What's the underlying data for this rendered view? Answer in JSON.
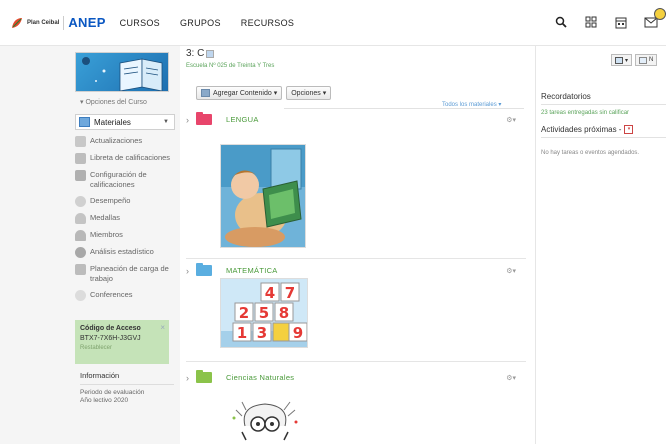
{
  "header": {
    "ceibal_label": "Plan Ceibal",
    "anep_label": "ANEP",
    "nav": [
      "CURSOS",
      "GRUPOS",
      "RECURSOS"
    ],
    "notification_count": ""
  },
  "sidebar": {
    "course_options": "▾ Opciones del Curso",
    "materials_select": "Materiales",
    "items": [
      {
        "label": "Actualizaciones",
        "icon": "updates-icon"
      },
      {
        "label": "Libreta de calificaciones",
        "icon": "gradebook-icon"
      },
      {
        "label": "Configuración de calificaciones",
        "icon": "grade-settings-icon"
      },
      {
        "label": "Desempeño",
        "icon": "performance-icon"
      },
      {
        "label": "Medallas",
        "icon": "badges-icon"
      },
      {
        "label": "Miembros",
        "icon": "members-icon"
      },
      {
        "label": "Análisis estadístico",
        "icon": "analytics-icon"
      },
      {
        "label": "Planeación de carga de trabajo",
        "icon": "workload-icon"
      },
      {
        "label": "Conferences",
        "icon": "conferences-icon"
      }
    ],
    "access": {
      "title": "Código de Acceso",
      "code": "BTX7-7X6H-J3GVJ",
      "reset": "Restablecer",
      "close": "×"
    },
    "info": {
      "title": "Información",
      "line1": "Periodo de evaluación",
      "line2": "Año lectivo 2020"
    }
  },
  "main": {
    "course_title": "3: C",
    "school": "Escuela Nº 025 de Treinta Y Tres",
    "add_content": "Agregar Contenido ▾",
    "options": "Opciones ▾",
    "all_materials": "Todos los materiales ▾",
    "folders": [
      {
        "name": "LENGUA",
        "color": "#e8456b"
      },
      {
        "name": "MATEMÁTICA",
        "color": "#5aaee0"
      },
      {
        "name": "Ciencias Naturales",
        "color": "#8bc34a"
      }
    ]
  },
  "right": {
    "new_label": "N",
    "reminders_title": "Recordatorios",
    "reminders_text": "23 tareas entregadas sin calificar",
    "upcoming_title": "Actividades próximas -",
    "upcoming_text": "No hay tareas o eventos agendados."
  }
}
